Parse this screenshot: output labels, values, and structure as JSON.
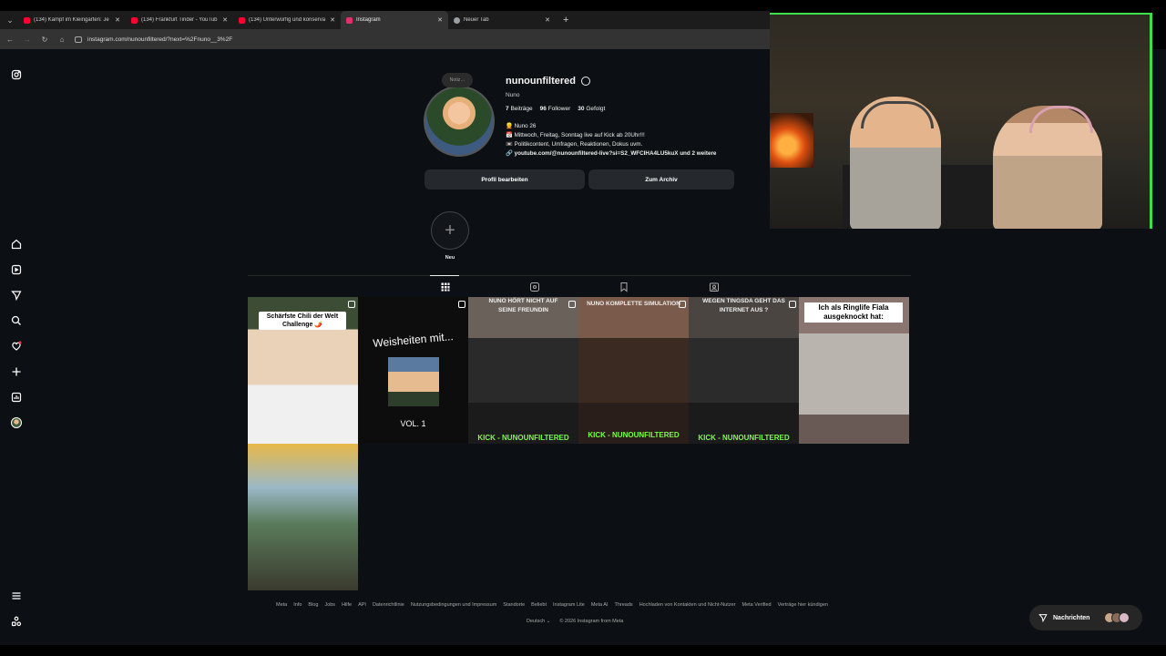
{
  "browser": {
    "tabs": [
      {
        "title": "(134) Kampf im Kleingarten: Je",
        "favicon_color": "#ff0033",
        "active": false
      },
      {
        "title": "(134) Frankfurt Tinder - YouTub",
        "favicon_color": "#ff0033",
        "active": false
      },
      {
        "title": "(134) Unterwürfig und konserva",
        "favicon_color": "#ff0033",
        "active": false
      },
      {
        "title": "Instagram",
        "favicon_color": "#e1306c",
        "active": true
      },
      {
        "title": "Neuer Tab",
        "favicon_color": "#9aa0a6",
        "active": false
      }
    ],
    "url": "instagram.com/nunounfiltered/?next=%2Fnuno__3%2F"
  },
  "profile": {
    "note": "Notiz…",
    "username": "nunounfiltered",
    "full_name": "Nuno",
    "stats": {
      "posts": "7",
      "posts_label": "Beiträge",
      "followers": "96",
      "followers_label": "Follower",
      "following": "30",
      "following_label": "Gefolgt"
    },
    "bio": [
      "👱 Nuno 26",
      "📅 Mittwoch, Freitag, Sonntag live auf Kick ab 20Uhr!!!",
      "📼 Politikcontent, Umfragen, Reaktionen, Dokus uvm."
    ],
    "link": "youtube.com/@nunounfiltered-live?si=S2_WFCIHA4LU5kuX und 2 weitere",
    "edit_button": "Profil bearbeiten",
    "archive_button": "Zum Archiv",
    "new_highlight": "Neu"
  },
  "posts": [
    {
      "caption": "Schärfste Chili der Welt Challenge 🌶️",
      "overlay": "",
      "bg": "#5a4a3c"
    },
    {
      "caption": "Weisheiten mit...",
      "overlay": "VOL. 1",
      "bg": "#111111"
    },
    {
      "caption": "NUNO HÖRT NICHT AUF SEINE FREUNDIN",
      "overlay": "KICK - NUNOUNFILTERED",
      "bg": "#2a2a2a"
    },
    {
      "caption": "NUNO KOMPLETTE SIMULATION",
      "overlay": "KICK - NUNOUNFILTERED",
      "bg": "#3a2a22"
    },
    {
      "caption": "WEGEN TINGSDA GEHT DAS INTERNET AUS ?",
      "overlay": "KICK - NUNOUNFILTERED",
      "bg": "#2b2b2b"
    },
    {
      "caption": "Ich als Ringlife Fiala ausgeknockt hat:",
      "overlay": "",
      "bg": "#7a6a66"
    },
    {
      "caption": "",
      "overlay": "",
      "bg": "#6a8a9a"
    }
  ],
  "footer": {
    "links": [
      "Meta",
      "Info",
      "Blog",
      "Jobs",
      "Hilfe",
      "API",
      "Datenrichtlinie",
      "Nutzungsbedingungen und Impressum",
      "Standorte",
      "Beliebt",
      "Instagram Lite",
      "Meta AI",
      "Threads",
      "Hochladen von Kontakten und Nicht-Nutzer",
      "Meta Verified",
      "Verträge hier kündigen"
    ],
    "language": "Deutsch",
    "copyright": "© 2026 Instagram from Meta"
  },
  "messages_label": "Nachrichten"
}
